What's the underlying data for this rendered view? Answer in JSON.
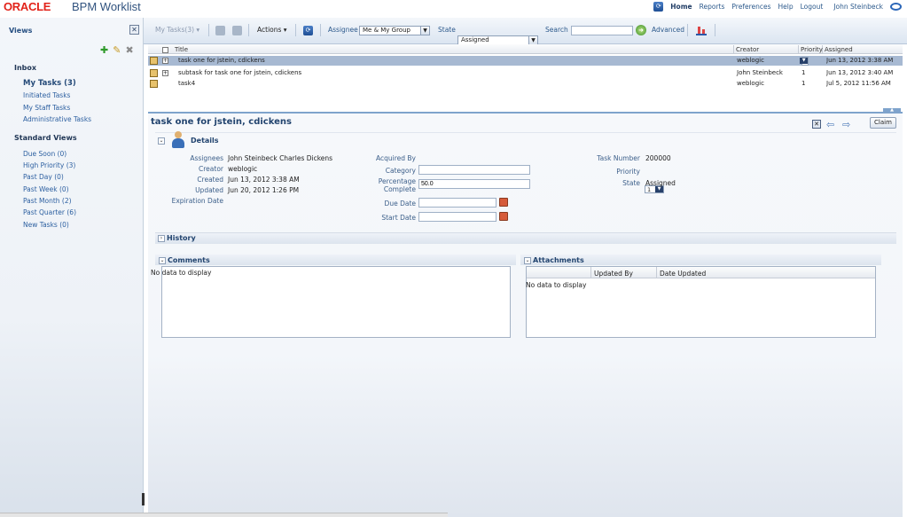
{
  "header": {
    "logo_oracle": "ORACLE",
    "logo_app": "BPM Worklist",
    "links": [
      "Home",
      "Reports",
      "Preferences",
      "Help",
      "Logout"
    ],
    "user": "John Steinbeck"
  },
  "sidebar": {
    "title": "Views",
    "inbox_heading": "Inbox",
    "inbox_items": [
      "My Tasks (3)",
      "Initiated Tasks",
      "My Staff Tasks",
      "Administrative Tasks"
    ],
    "standard_heading": "Standard Views",
    "standard_items": [
      "Due Soon (0)",
      "High Priority (3)",
      "Past Day (0)",
      "Past Week (0)",
      "Past Month (2)",
      "Past Quarter (6)",
      "New Tasks (0)"
    ]
  },
  "toolbar": {
    "my_tasks": "My Tasks(3)",
    "actions": "Actions",
    "assignee_label": "Assignee",
    "assignee_value": "Me & My Group",
    "state_label": "State",
    "state_value": "Assigned",
    "search_label": "Search",
    "search_value": "",
    "advanced": "Advanced"
  },
  "table": {
    "columns": [
      "Title",
      "Creator",
      "Priority",
      "Assigned"
    ],
    "rows": [
      {
        "title": "task one for jstein, cdickens",
        "creator": "weblogic",
        "priority": "1",
        "assigned": "Jun 13, 2012 3:38 AM"
      },
      {
        "title": "subtask for task one for jstein, cdickens",
        "creator": "John Steinbeck",
        "priority": "1",
        "assigned": "Jun 13, 2012 3:40 AM"
      },
      {
        "title": "task4",
        "creator": "weblogic",
        "priority": "1",
        "assigned": "Jul 5, 2012 11:56 AM"
      }
    ]
  },
  "detail": {
    "title": "task one for jstein, cdickens",
    "claim": "Claim",
    "details_heading": "Details",
    "assignees_label": "Assignees",
    "assignees_value": "John Steinbeck Charles Dickens",
    "creator_label": "Creator",
    "creator_value": "weblogic",
    "created_label": "Created",
    "created_value": "Jun 13, 2012 3:38 AM",
    "updated_label": "Updated",
    "updated_value": "Jun 20, 2012 1:26 PM",
    "expiration_label": "Expiration Date",
    "acquired_label": "Acquired By",
    "category_label": "Category",
    "category_value": "",
    "percentage_label_1": "Percentage",
    "percentage_label_2": "Complete",
    "percentage_value": "50.0",
    "due_label": "Due Date",
    "due_value": "",
    "start_label": "Start Date",
    "start_value": "",
    "task_number_label": "Task Number",
    "task_number_value": "200000",
    "priority_label": "Priority",
    "priority_value": "1",
    "state_label": "State",
    "state_value": "Assigned",
    "history_heading": "History",
    "comments_heading": "Comments",
    "comments_empty": "No data to display",
    "attachments_heading": "Attachments",
    "attachments_columns": [
      "Updated By",
      "Date Updated"
    ],
    "attachments_empty": "No data to display"
  }
}
